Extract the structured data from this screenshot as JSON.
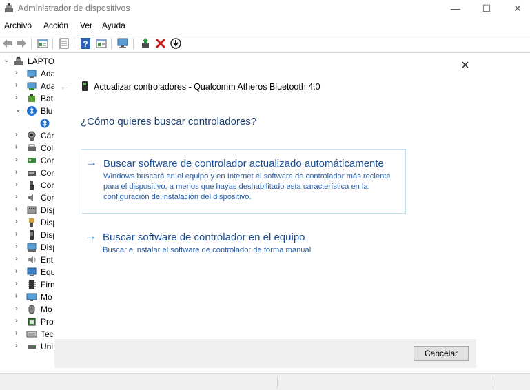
{
  "window": {
    "title": "Administrador de dispositivos",
    "minimize": "—",
    "maximize": "☐",
    "close": "✕"
  },
  "menu": [
    "Archivo",
    "Acción",
    "Ver",
    "Ayuda"
  ],
  "toolbar_icons": [
    "back-icon",
    "forward-icon",
    "properties-icon",
    "list-icon",
    "help-icon",
    "details-icon",
    "monitor-icon",
    "update-driver-icon",
    "uninstall-icon",
    "download-icon"
  ],
  "tree": {
    "root": "LAPTO",
    "items": [
      {
        "label": "Ada",
        "icon": "audio-icon",
        "expanded": false
      },
      {
        "label": "Ada",
        "icon": "network-adapter-icon",
        "expanded": false
      },
      {
        "label": "Bat",
        "icon": "battery-icon",
        "expanded": false
      },
      {
        "label": "Blu",
        "icon": "bluetooth-icon",
        "expanded": true
      },
      {
        "label": "",
        "icon": "bluetooth-device-icon",
        "child": true
      },
      {
        "label": "Cár",
        "icon": "camera-icon",
        "expanded": false
      },
      {
        "label": "Col",
        "icon": "print-queue-icon",
        "expanded": false
      },
      {
        "label": "Cor",
        "icon": "controller-icon",
        "expanded": false
      },
      {
        "label": "Cor",
        "icon": "storage-controller-icon",
        "expanded": false
      },
      {
        "label": "Cor",
        "icon": "usb-icon",
        "expanded": false
      },
      {
        "label": "Cor",
        "icon": "sound-controller-icon",
        "expanded": false
      },
      {
        "label": "Disp",
        "icon": "hid-icon",
        "expanded": false
      },
      {
        "label": "Disp",
        "icon": "security-device-icon",
        "expanded": false
      },
      {
        "label": "Disp",
        "icon": "software-device-icon",
        "expanded": false
      },
      {
        "label": "Disp",
        "icon": "system-device-icon",
        "expanded": false
      },
      {
        "label": "Ent",
        "icon": "audio-io-icon",
        "expanded": false
      },
      {
        "label": "Equ",
        "icon": "computer-icon",
        "expanded": false
      },
      {
        "label": "Firn",
        "icon": "firmware-icon",
        "expanded": false
      },
      {
        "label": "Mo",
        "icon": "monitor-icon",
        "expanded": false
      },
      {
        "label": "Mo",
        "icon": "mouse-icon",
        "expanded": false
      },
      {
        "label": "Pro",
        "icon": "processor-icon",
        "expanded": false
      },
      {
        "label": "Tec",
        "icon": "keyboard-icon",
        "expanded": false
      },
      {
        "label": "Uni",
        "icon": "disk-drive-icon",
        "expanded": false
      }
    ]
  },
  "dialog": {
    "title": "Actualizar controladores - Qualcomm Atheros Bluetooth 4.0",
    "question": "¿Cómo quieres buscar controladores?",
    "options": [
      {
        "title": "Buscar software de controlador actualizado automáticamente",
        "desc": "Windows buscará en el equipo y en Internet el software de controlador más reciente para el dispositivo, a menos que hayas deshabilitado esta característica en la configuración de instalación del dispositivo."
      },
      {
        "title": "Buscar software de controlador en el equipo",
        "desc": "Buscar e instalar el software de controlador de forma manual."
      }
    ],
    "cancel_label": "Cancelar"
  },
  "colors": {
    "accent_text": "#1a4f99",
    "question": "#1a3e72",
    "option_border": "#bfe0f5",
    "footer_bg": "#f0f0f0"
  }
}
